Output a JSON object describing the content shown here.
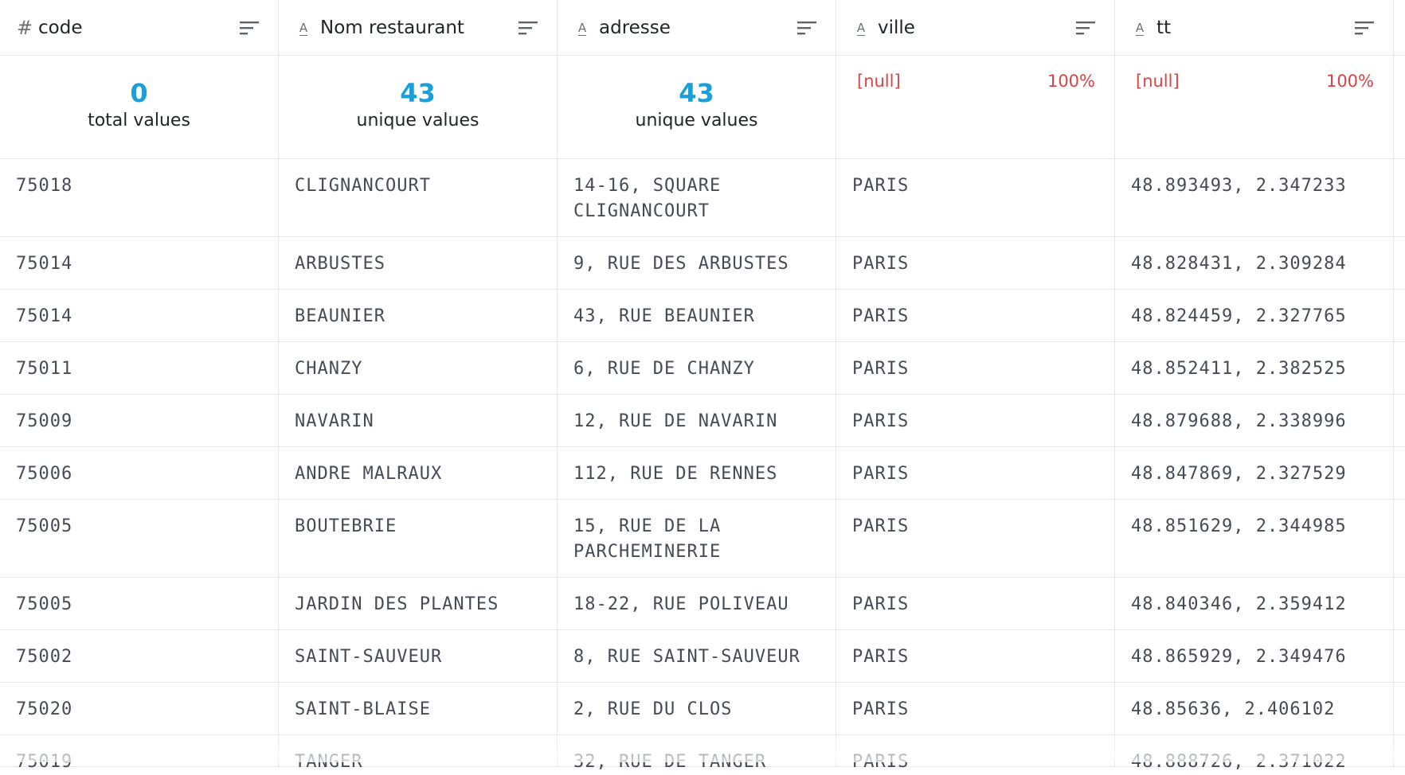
{
  "columns": [
    {
      "name": "code",
      "type_icon": "hash-icon",
      "type_glyph": "#"
    },
    {
      "name": "Nom restaurant",
      "type_icon": "text-type-icon",
      "type_glyph": "A"
    },
    {
      "name": "adresse",
      "type_icon": "text-type-icon",
      "type_glyph": "A"
    },
    {
      "name": "ville",
      "type_icon": "text-type-icon",
      "type_glyph": "A"
    },
    {
      "name": "tt",
      "type_icon": "text-type-icon",
      "type_glyph": "A"
    }
  ],
  "stats": {
    "code": {
      "value": "0",
      "label": "total values"
    },
    "nom": {
      "value": "43",
      "label": "unique values"
    },
    "adresse": {
      "value": "43",
      "label": "unique values"
    },
    "ville": {
      "null_label": "[null]",
      "null_pct": "100%"
    },
    "tt": {
      "null_label": "[null]",
      "null_pct": "100%"
    }
  },
  "rows": [
    {
      "code": "75018",
      "nom": "CLIGNANCOURT",
      "adresse": "14-16, SQUARE CLIGNANCOURT",
      "ville": "PARIS",
      "tt": "48.893493, 2.347233"
    },
    {
      "code": "75014",
      "nom": "ARBUSTES",
      "adresse": "9, RUE DES ARBUSTES",
      "ville": "PARIS",
      "tt": "48.828431, 2.309284"
    },
    {
      "code": "75014",
      "nom": "BEAUNIER",
      "adresse": "43, RUE BEAUNIER",
      "ville": "PARIS",
      "tt": "48.824459, 2.327765"
    },
    {
      "code": "75011",
      "nom": "CHANZY",
      "adresse": "6, RUE DE CHANZY",
      "ville": "PARIS",
      "tt": "48.852411, 2.382525"
    },
    {
      "code": "75009",
      "nom": "NAVARIN",
      "adresse": "12, RUE DE NAVARIN",
      "ville": "PARIS",
      "tt": "48.879688, 2.338996"
    },
    {
      "code": "75006",
      "nom": "ANDRE MALRAUX",
      "adresse": "112, RUE DE RENNES",
      "ville": "PARIS",
      "tt": "48.847869, 2.327529"
    },
    {
      "code": "75005",
      "nom": "BOUTEBRIE",
      "adresse": "15, RUE DE LA PARCHEMINERIE",
      "ville": "PARIS",
      "tt": "48.851629, 2.344985"
    },
    {
      "code": "75005",
      "nom": "JARDIN DES PLANTES",
      "adresse": "18-22, RUE POLIVEAU",
      "ville": "PARIS",
      "tt": "48.840346, 2.359412"
    },
    {
      "code": "75002",
      "nom": "SAINT-SAUVEUR",
      "adresse": "8, RUE SAINT-SAUVEUR",
      "ville": "PARIS",
      "tt": "48.865929, 2.349476"
    },
    {
      "code": "75020",
      "nom": "SAINT-BLAISE",
      "adresse": "2, RUE DU CLOS",
      "ville": "PARIS",
      "tt": "48.85636, 2.406102"
    },
    {
      "code": "75019",
      "nom": "TANGER",
      "adresse": "32, RUE DE TANGER",
      "ville": "PARIS",
      "tt": "48.888726, 2.371022"
    }
  ]
}
